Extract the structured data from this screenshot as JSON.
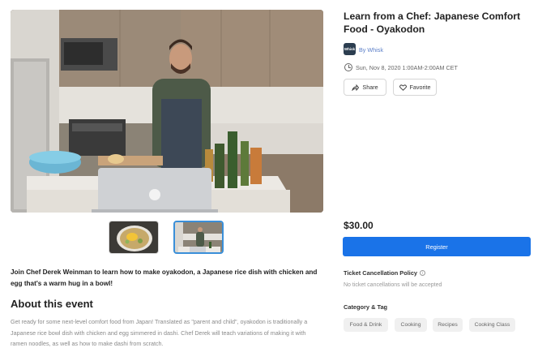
{
  "event": {
    "title": "Learn from a Chef: Japanese Comfort Food - Oyakodon",
    "organizer_logo_text": "Whisk",
    "organizer_link": "By Whisk",
    "datetime": "Sun, Nov 8, 2020 1:00AM-2:00AM CET",
    "share_label": "Share",
    "favorite_label": "Favorite"
  },
  "gallery": {
    "hero_alt": "Chef cooking in kitchen with laptop",
    "thumbnails": [
      "oyakodon-bowl",
      "chef-in-kitchen"
    ],
    "selected_index": 1
  },
  "intro": "Join Chef Derek Weinman to learn how to make oyakodon, a Japanese rice dish with chicken and egg that's a warm hug in a bowl!",
  "about": {
    "heading": "About this event",
    "body": "Get ready for some next-level comfort food from Japan! Translated as \"parent and child\", oyakodon is traditionally a Japanese rice bowl dish with chicken and egg simmered in dashi. Chef Derek will teach variations of making it with ramen noodles, as well as how to make dashi from scratch."
  },
  "ticket": {
    "price": "$30.00",
    "register_label": "Register"
  },
  "policy": {
    "heading": "Ticket Cancellation Policy",
    "info_icon": "info-icon",
    "text": "No ticket cancellations will be accepted"
  },
  "tags": {
    "heading": "Category & Tag",
    "items": [
      "Food & Drink",
      "Cooking",
      "Recipes",
      "Cooking Class"
    ]
  },
  "colors": {
    "accent": "#1a73e8",
    "link": "#5b7fc8",
    "selected_thumb_border": "#3a8fd9"
  }
}
